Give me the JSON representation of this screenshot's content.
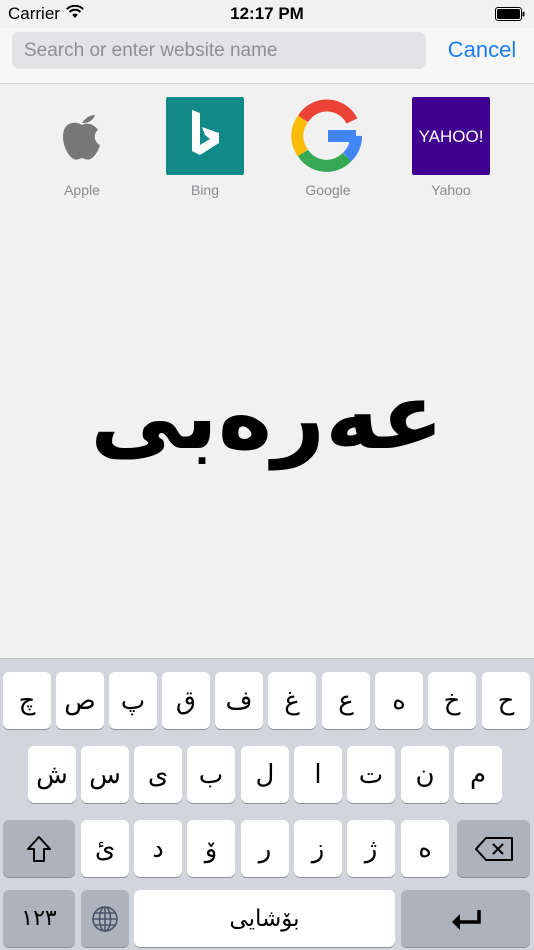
{
  "status_bar": {
    "carrier": "Carrier",
    "time": "12:17 PM"
  },
  "search": {
    "placeholder": "Search or enter website name",
    "value": ""
  },
  "cancel_label": "Cancel",
  "favorites": [
    {
      "label": "Apple",
      "icon": "apple-logo-icon"
    },
    {
      "label": "Bing",
      "icon": "bing-logo-icon"
    },
    {
      "label": "Google",
      "icon": "google-logo-icon"
    },
    {
      "label": "Yahoo",
      "icon": "yahoo-logo-icon",
      "logo_text": "YAHOO!"
    }
  ],
  "main_title": "عەرەبی",
  "keyboard": {
    "row1": [
      "چ",
      "ص",
      "پ",
      "ق",
      "ف",
      "غ",
      "ع",
      "ه",
      "خ",
      "ح"
    ],
    "row2": [
      "ش",
      "س",
      "ی",
      "ب",
      "ل",
      "ا",
      "ت",
      "ن",
      "م"
    ],
    "row3": [
      "ئ",
      "د",
      "ۆ",
      "ر",
      "ز",
      "ژ",
      "ە"
    ],
    "numbers_label": "١٢٣",
    "space_label": "بۆشایی"
  },
  "colors": {
    "accent": "#1a7cf7",
    "bing": "#138a8a",
    "yahoo": "#400191"
  }
}
